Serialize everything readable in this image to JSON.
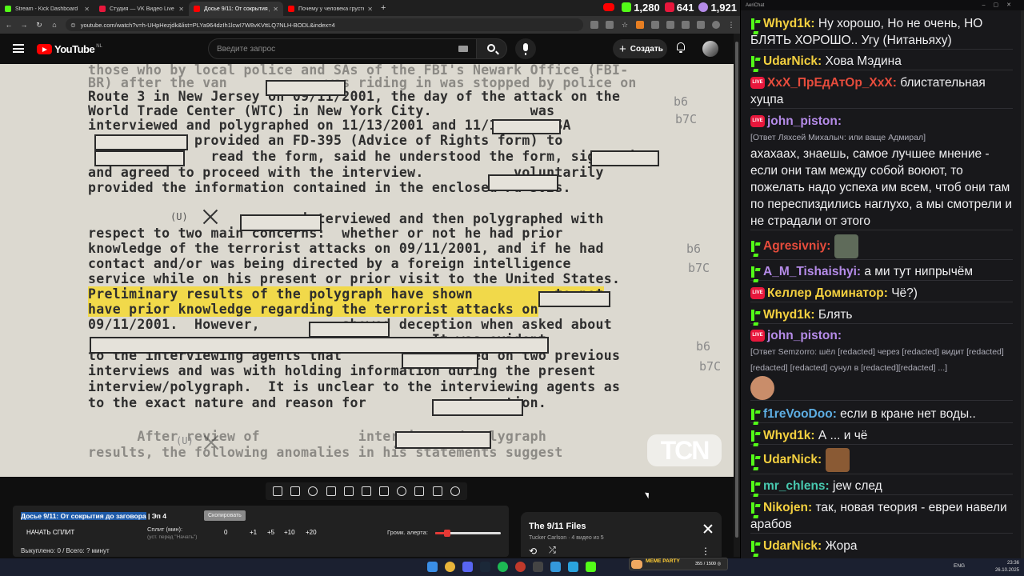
{
  "browser": {
    "tabs": [
      {
        "label": "Stream - Kick Dashboard",
        "color": "#53fc18",
        "active": false
      },
      {
        "label": "Студия — VK Видео Live",
        "color": "#e8173c",
        "active": false
      },
      {
        "label": "Досье 9/11: От сокрытия д",
        "color": "#ff0000",
        "active": true
      },
      {
        "label": "Почему у человека грустно в",
        "color": "#ff0000",
        "active": false
      }
    ],
    "url": "youtube.com/watch?v=h-UHpHezjdk&list=PLYa964dzIh1lcwI7W8vKVttLQ7NLH-BODL&index=4"
  },
  "stats": {
    "youtube": "1,280",
    "kick": "641",
    "vk": "1,921"
  },
  "youtube": {
    "logo": "YouTube",
    "country": "NL",
    "search_placeholder": "Введите запрос",
    "create_label": "Создать"
  },
  "document": {
    "lines": [
      {
        "text": "those who by local police and SAs of the FBI's Newark Office (FBI-",
        "faint": true
      },
      {
        "text": "BR) after the van            was riding in was stopped by police on",
        "faint": true
      },
      {
        "text": "Route 3 in New Jersey on 09/11/2001, the day of the attack on the",
        "faint": false
      },
      {
        "text": "World Trade Center (WTC) in New York City.            was",
        "faint": false
      },
      {
        "text": "interviewed and polygraphed on 11/13/2001 and 11/16/2001.SA",
        "faint": false
      },
      {
        "text": "             provided an FD-395 (Advice of Rights form) to",
        "faint": false
      },
      {
        "text": "               read the form, said he understood the form, signed it",
        "faint": false
      },
      {
        "text": "and agreed to proceed with the interview.           voluntarily",
        "faint": false
      },
      {
        "text": "provided the information contained in the enclosed Fd-302s.",
        "faint": false
      },
      {
        "text": "                      was interviewed and then polygraphed with",
        "faint": false
      },
      {
        "text": "respect to two main concerns:  whether or not he had prior",
        "faint": false
      },
      {
        "text": "knowledge of the terrorist attacks on 09/11/2001, and if he had",
        "faint": false
      },
      {
        "text": "contact and/or was being directed by a foreign intelligence",
        "faint": false
      },
      {
        "text": "service while on his present or prior visit to the United States.",
        "faint": false
      },
      {
        "text": "Preliminary results of the polygraph have shown          to not",
        "faint": false
      },
      {
        "text": "have prior knowledge regarding the terrorist attacks on",
        "faint": false
      },
      {
        "text": "09/11/2001.  However,          showed deception when asked about",
        "faint": false
      },
      {
        "text": "                                          It was evident",
        "faint": false
      },
      {
        "text": "to the interviewing agents that          had lied on two previous",
        "faint": false
      },
      {
        "text": "interviews and was with holding information during the present",
        "faint": false
      },
      {
        "text": "interview/polygraph.  It is unclear to the interviewing agents as",
        "faint": false
      },
      {
        "text": "to the exact nature and reason for            deception.",
        "faint": false
      },
      {
        "text": "      After review of            interview and polygraph",
        "faint": true
      },
      {
        "text": "results, the following anomalies in his statements suggest",
        "faint": true
      }
    ],
    "u_mark": "(U)",
    "margin_codes": [
      "b6",
      "b7C",
      "b6",
      "b7C",
      "b6",
      "b7C"
    ],
    "watermark": "TCN"
  },
  "extension": {
    "title": "Досье 9/11: От сокрытия до заговора",
    "title_rest": " | Эп 4",
    "badge": "Скопировать",
    "start_label": "НАЧАТЬ СПЛИТ",
    "split_label": "Сплит (мин):",
    "split_hint": "(уст. перед \"Начать\")",
    "values": [
      "0",
      "+1",
      "+5",
      "+10",
      "+20"
    ],
    "alert_label": "Громк. алерта:",
    "alert_volume": 0.18,
    "skipped": "Выкуплено: 0 / Всего: ? минут"
  },
  "playlist": {
    "title": "The 9/11 Files",
    "subtitle": "Tucker Carlson · 4 видео из 5"
  },
  "chat": {
    "window_title": "AeriChat",
    "messages": [
      {
        "badge": "kick",
        "nick": "Whyd1k:",
        "color": "#f4d03f",
        "text": " Ну хорошо, Но не очень, НО БЛЯТЬ ХОРОШО.. Угу (Нитаньяху)"
      },
      {
        "badge": "kick",
        "nick": "UdarNick:",
        "color": "#f4d03f",
        "text": " Хова Мэдина"
      },
      {
        "badge": "live",
        "nick": "XxX_ПрЕдАтОр_XxX:",
        "color": "#e74c3c",
        "text": " блистательная хуцпа"
      },
      {
        "badge": "live",
        "nick": "john_piston:",
        "color": "#b58be8",
        "reply": "[Ответ Ляхсей Михалыч: или ваще Адмирал]",
        "text": "ахахаах, знаешь, самое лучшее мнение - если они там между собой воюют, то пожелать надо успеха им всем, чтоб они там по переспиздились наглухо, а мы смотрели и не страдали от этого"
      },
      {
        "badge": "kick",
        "nick": "Agresivniy:",
        "color": "#e74c3c",
        "text": ""
      },
      {
        "badge": "kick",
        "nick": "A_M_Tishaishyi:",
        "color": "#b58be8",
        "text": " а ми тут нипрычём"
      },
      {
        "badge": "live",
        "nick": "Келлер Доминатор:",
        "color": "#f4d03f",
        "text": " Чё?)"
      },
      {
        "badge": "kick",
        "nick": "Whyd1k:",
        "color": "#f4d03f",
        "text": " Блять"
      },
      {
        "badge": "live",
        "nick": "john_piston:",
        "color": "#b58be8",
        "reply": "[Ответ Semzorro: шёл [redacted] через [redacted] видит [redacted] [redacted] [redacted] сунул в [redacted][redacted] ...]",
        "text": ""
      },
      {
        "badge": "kick",
        "nick": "f1reVooDoo:",
        "color": "#5dade2",
        "text": " если в кране нет воды.."
      },
      {
        "badge": "kick",
        "nick": "Whyd1k:",
        "color": "#f4d03f",
        "text": " А ... и чё"
      },
      {
        "badge": "kick",
        "nick": "UdarNick:",
        "color": "#f4d03f",
        "text": ""
      },
      {
        "badge": "kick",
        "nick": "mr_chlens:",
        "color": "#48c9b0",
        "text": " jew след"
      },
      {
        "badge": "kick",
        "nick": "Nikojen:",
        "color": "#f4d03f",
        "text": " так, новая теория - евреи навели арабов"
      },
      {
        "badge": "kick",
        "nick": "UdarNick:",
        "color": "#f4d03f",
        "text": " Жора"
      }
    ]
  },
  "taskbar": {
    "lang": "ENG",
    "time": "23:36",
    "date": "26.10.2025",
    "meme_title": "MEME PARTY",
    "meme_counter": "355 / 1500 ◎"
  }
}
